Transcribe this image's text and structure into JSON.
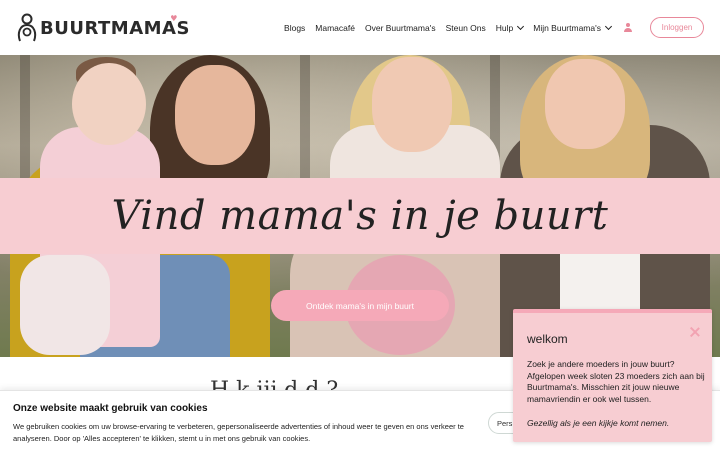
{
  "header": {
    "logo_text": "BUURTMAMAS",
    "nav": [
      {
        "label": "Blogs",
        "dropdown": false
      },
      {
        "label": "Mamacafé",
        "dropdown": false
      },
      {
        "label": "Over Buurtmama's",
        "dropdown": false
      },
      {
        "label": "Steun Ons",
        "dropdown": false
      },
      {
        "label": "Hulp",
        "dropdown": true
      },
      {
        "label": "Mijn Buurtmama's",
        "dropdown": true
      }
    ],
    "login_label": "Inloggen"
  },
  "hero": {
    "title": "Vind mama's in je buurt",
    "cta_label": "Ontdek mama's in mijn buurt"
  },
  "section": {
    "heading": "H                    k  ijj  d                 d  ?"
  },
  "cookie": {
    "title": "Onze website maakt gebruik van cookies",
    "text": "We gebruiken cookies om uw browse-ervaring te verbeteren, gepersonaliseerde advertenties of inhoud weer te geven en ons verkeer te analyseren. Door op 'Alles accepteren' te klikken, stemt u in met ons gebruik van cookies.",
    "button_label": "Pers"
  },
  "popup": {
    "title": "welkom",
    "body": "Zoek je andere moeders in jouw buurt? Afgelopen week sloten 23 moeders zich aan bij Buurtmama's. Misschien zit jouw nieuwe mamavriendin er ook wel tussen.",
    "footer": "Gezellig als je een kijkje komt nemen."
  },
  "colors": {
    "accent": "#e8889a",
    "band": "#f7cdd2",
    "button": "#f5a9b8"
  }
}
